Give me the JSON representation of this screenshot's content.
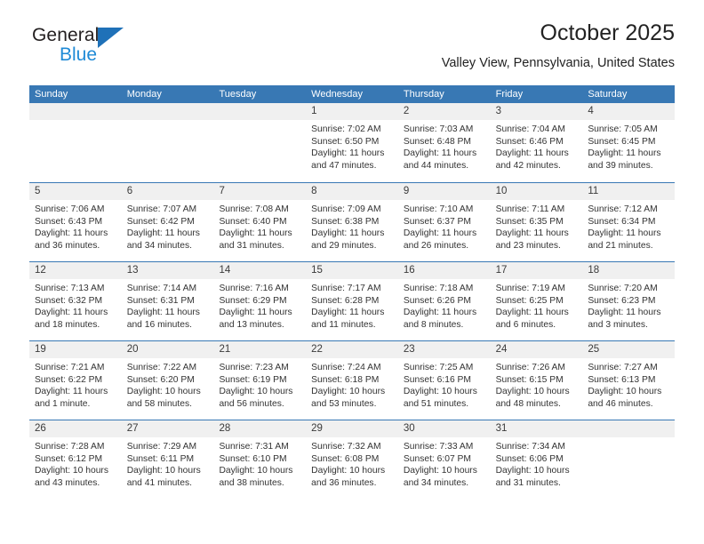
{
  "brand": {
    "name_dark": "General",
    "name_light": "Blue"
  },
  "header": {
    "title": "October 2025",
    "subtitle": "Valley View, Pennsylvania, United States"
  },
  "colors": {
    "header_blue": "#3878b4",
    "brand_blue": "#1f8ad6",
    "band_gray": "#f0f0f0"
  },
  "weekdays": [
    "Sunday",
    "Monday",
    "Tuesday",
    "Wednesday",
    "Thursday",
    "Friday",
    "Saturday"
  ],
  "weeks": [
    [
      {
        "day": "",
        "empty": true
      },
      {
        "day": "",
        "empty": true
      },
      {
        "day": "",
        "empty": true
      },
      {
        "day": "1",
        "sunrise": "Sunrise: 7:02 AM",
        "sunset": "Sunset: 6:50 PM",
        "daylight": "Daylight: 11 hours and 47 minutes."
      },
      {
        "day": "2",
        "sunrise": "Sunrise: 7:03 AM",
        "sunset": "Sunset: 6:48 PM",
        "daylight": "Daylight: 11 hours and 44 minutes."
      },
      {
        "day": "3",
        "sunrise": "Sunrise: 7:04 AM",
        "sunset": "Sunset: 6:46 PM",
        "daylight": "Daylight: 11 hours and 42 minutes."
      },
      {
        "day": "4",
        "sunrise": "Sunrise: 7:05 AM",
        "sunset": "Sunset: 6:45 PM",
        "daylight": "Daylight: 11 hours and 39 minutes."
      }
    ],
    [
      {
        "day": "5",
        "sunrise": "Sunrise: 7:06 AM",
        "sunset": "Sunset: 6:43 PM",
        "daylight": "Daylight: 11 hours and 36 minutes."
      },
      {
        "day": "6",
        "sunrise": "Sunrise: 7:07 AM",
        "sunset": "Sunset: 6:42 PM",
        "daylight": "Daylight: 11 hours and 34 minutes."
      },
      {
        "day": "7",
        "sunrise": "Sunrise: 7:08 AM",
        "sunset": "Sunset: 6:40 PM",
        "daylight": "Daylight: 11 hours and 31 minutes."
      },
      {
        "day": "8",
        "sunrise": "Sunrise: 7:09 AM",
        "sunset": "Sunset: 6:38 PM",
        "daylight": "Daylight: 11 hours and 29 minutes."
      },
      {
        "day": "9",
        "sunrise": "Sunrise: 7:10 AM",
        "sunset": "Sunset: 6:37 PM",
        "daylight": "Daylight: 11 hours and 26 minutes."
      },
      {
        "day": "10",
        "sunrise": "Sunrise: 7:11 AM",
        "sunset": "Sunset: 6:35 PM",
        "daylight": "Daylight: 11 hours and 23 minutes."
      },
      {
        "day": "11",
        "sunrise": "Sunrise: 7:12 AM",
        "sunset": "Sunset: 6:34 PM",
        "daylight": "Daylight: 11 hours and 21 minutes."
      }
    ],
    [
      {
        "day": "12",
        "sunrise": "Sunrise: 7:13 AM",
        "sunset": "Sunset: 6:32 PM",
        "daylight": "Daylight: 11 hours and 18 minutes."
      },
      {
        "day": "13",
        "sunrise": "Sunrise: 7:14 AM",
        "sunset": "Sunset: 6:31 PM",
        "daylight": "Daylight: 11 hours and 16 minutes."
      },
      {
        "day": "14",
        "sunrise": "Sunrise: 7:16 AM",
        "sunset": "Sunset: 6:29 PM",
        "daylight": "Daylight: 11 hours and 13 minutes."
      },
      {
        "day": "15",
        "sunrise": "Sunrise: 7:17 AM",
        "sunset": "Sunset: 6:28 PM",
        "daylight": "Daylight: 11 hours and 11 minutes."
      },
      {
        "day": "16",
        "sunrise": "Sunrise: 7:18 AM",
        "sunset": "Sunset: 6:26 PM",
        "daylight": "Daylight: 11 hours and 8 minutes."
      },
      {
        "day": "17",
        "sunrise": "Sunrise: 7:19 AM",
        "sunset": "Sunset: 6:25 PM",
        "daylight": "Daylight: 11 hours and 6 minutes."
      },
      {
        "day": "18",
        "sunrise": "Sunrise: 7:20 AM",
        "sunset": "Sunset: 6:23 PM",
        "daylight": "Daylight: 11 hours and 3 minutes."
      }
    ],
    [
      {
        "day": "19",
        "sunrise": "Sunrise: 7:21 AM",
        "sunset": "Sunset: 6:22 PM",
        "daylight": "Daylight: 11 hours and 1 minute."
      },
      {
        "day": "20",
        "sunrise": "Sunrise: 7:22 AM",
        "sunset": "Sunset: 6:20 PM",
        "daylight": "Daylight: 10 hours and 58 minutes."
      },
      {
        "day": "21",
        "sunrise": "Sunrise: 7:23 AM",
        "sunset": "Sunset: 6:19 PM",
        "daylight": "Daylight: 10 hours and 56 minutes."
      },
      {
        "day": "22",
        "sunrise": "Sunrise: 7:24 AM",
        "sunset": "Sunset: 6:18 PM",
        "daylight": "Daylight: 10 hours and 53 minutes."
      },
      {
        "day": "23",
        "sunrise": "Sunrise: 7:25 AM",
        "sunset": "Sunset: 6:16 PM",
        "daylight": "Daylight: 10 hours and 51 minutes."
      },
      {
        "day": "24",
        "sunrise": "Sunrise: 7:26 AM",
        "sunset": "Sunset: 6:15 PM",
        "daylight": "Daylight: 10 hours and 48 minutes."
      },
      {
        "day": "25",
        "sunrise": "Sunrise: 7:27 AM",
        "sunset": "Sunset: 6:13 PM",
        "daylight": "Daylight: 10 hours and 46 minutes."
      }
    ],
    [
      {
        "day": "26",
        "sunrise": "Sunrise: 7:28 AM",
        "sunset": "Sunset: 6:12 PM",
        "daylight": "Daylight: 10 hours and 43 minutes."
      },
      {
        "day": "27",
        "sunrise": "Sunrise: 7:29 AM",
        "sunset": "Sunset: 6:11 PM",
        "daylight": "Daylight: 10 hours and 41 minutes."
      },
      {
        "day": "28",
        "sunrise": "Sunrise: 7:31 AM",
        "sunset": "Sunset: 6:10 PM",
        "daylight": "Daylight: 10 hours and 38 minutes."
      },
      {
        "day": "29",
        "sunrise": "Sunrise: 7:32 AM",
        "sunset": "Sunset: 6:08 PM",
        "daylight": "Daylight: 10 hours and 36 minutes."
      },
      {
        "day": "30",
        "sunrise": "Sunrise: 7:33 AM",
        "sunset": "Sunset: 6:07 PM",
        "daylight": "Daylight: 10 hours and 34 minutes."
      },
      {
        "day": "31",
        "sunrise": "Sunrise: 7:34 AM",
        "sunset": "Sunset: 6:06 PM",
        "daylight": "Daylight: 10 hours and 31 minutes."
      },
      {
        "day": "",
        "empty": true
      }
    ]
  ]
}
